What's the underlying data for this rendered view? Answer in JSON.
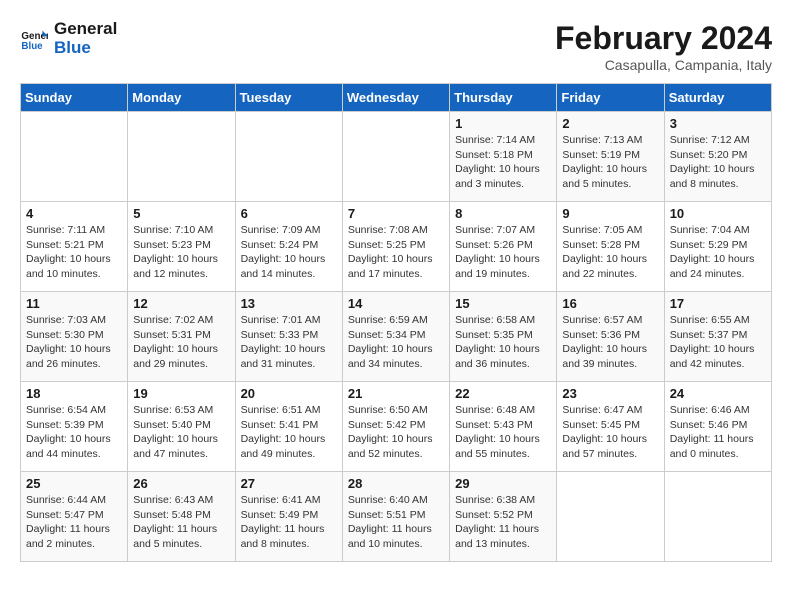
{
  "header": {
    "logo_line1": "General",
    "logo_line2": "Blue",
    "month_title": "February 2024",
    "subtitle": "Casapulla, Campania, Italy"
  },
  "weekdays": [
    "Sunday",
    "Monday",
    "Tuesday",
    "Wednesday",
    "Thursday",
    "Friday",
    "Saturday"
  ],
  "weeks": [
    [
      {
        "day": "",
        "info": ""
      },
      {
        "day": "",
        "info": ""
      },
      {
        "day": "",
        "info": ""
      },
      {
        "day": "",
        "info": ""
      },
      {
        "day": "1",
        "info": "Sunrise: 7:14 AM\nSunset: 5:18 PM\nDaylight: 10 hours\nand 3 minutes."
      },
      {
        "day": "2",
        "info": "Sunrise: 7:13 AM\nSunset: 5:19 PM\nDaylight: 10 hours\nand 5 minutes."
      },
      {
        "day": "3",
        "info": "Sunrise: 7:12 AM\nSunset: 5:20 PM\nDaylight: 10 hours\nand 8 minutes."
      }
    ],
    [
      {
        "day": "4",
        "info": "Sunrise: 7:11 AM\nSunset: 5:21 PM\nDaylight: 10 hours\nand 10 minutes."
      },
      {
        "day": "5",
        "info": "Sunrise: 7:10 AM\nSunset: 5:23 PM\nDaylight: 10 hours\nand 12 minutes."
      },
      {
        "day": "6",
        "info": "Sunrise: 7:09 AM\nSunset: 5:24 PM\nDaylight: 10 hours\nand 14 minutes."
      },
      {
        "day": "7",
        "info": "Sunrise: 7:08 AM\nSunset: 5:25 PM\nDaylight: 10 hours\nand 17 minutes."
      },
      {
        "day": "8",
        "info": "Sunrise: 7:07 AM\nSunset: 5:26 PM\nDaylight: 10 hours\nand 19 minutes."
      },
      {
        "day": "9",
        "info": "Sunrise: 7:05 AM\nSunset: 5:28 PM\nDaylight: 10 hours\nand 22 minutes."
      },
      {
        "day": "10",
        "info": "Sunrise: 7:04 AM\nSunset: 5:29 PM\nDaylight: 10 hours\nand 24 minutes."
      }
    ],
    [
      {
        "day": "11",
        "info": "Sunrise: 7:03 AM\nSunset: 5:30 PM\nDaylight: 10 hours\nand 26 minutes."
      },
      {
        "day": "12",
        "info": "Sunrise: 7:02 AM\nSunset: 5:31 PM\nDaylight: 10 hours\nand 29 minutes."
      },
      {
        "day": "13",
        "info": "Sunrise: 7:01 AM\nSunset: 5:33 PM\nDaylight: 10 hours\nand 31 minutes."
      },
      {
        "day": "14",
        "info": "Sunrise: 6:59 AM\nSunset: 5:34 PM\nDaylight: 10 hours\nand 34 minutes."
      },
      {
        "day": "15",
        "info": "Sunrise: 6:58 AM\nSunset: 5:35 PM\nDaylight: 10 hours\nand 36 minutes."
      },
      {
        "day": "16",
        "info": "Sunrise: 6:57 AM\nSunset: 5:36 PM\nDaylight: 10 hours\nand 39 minutes."
      },
      {
        "day": "17",
        "info": "Sunrise: 6:55 AM\nSunset: 5:37 PM\nDaylight: 10 hours\nand 42 minutes."
      }
    ],
    [
      {
        "day": "18",
        "info": "Sunrise: 6:54 AM\nSunset: 5:39 PM\nDaylight: 10 hours\nand 44 minutes."
      },
      {
        "day": "19",
        "info": "Sunrise: 6:53 AM\nSunset: 5:40 PM\nDaylight: 10 hours\nand 47 minutes."
      },
      {
        "day": "20",
        "info": "Sunrise: 6:51 AM\nSunset: 5:41 PM\nDaylight: 10 hours\nand 49 minutes."
      },
      {
        "day": "21",
        "info": "Sunrise: 6:50 AM\nSunset: 5:42 PM\nDaylight: 10 hours\nand 52 minutes."
      },
      {
        "day": "22",
        "info": "Sunrise: 6:48 AM\nSunset: 5:43 PM\nDaylight: 10 hours\nand 55 minutes."
      },
      {
        "day": "23",
        "info": "Sunrise: 6:47 AM\nSunset: 5:45 PM\nDaylight: 10 hours\nand 57 minutes."
      },
      {
        "day": "24",
        "info": "Sunrise: 6:46 AM\nSunset: 5:46 PM\nDaylight: 11 hours\nand 0 minutes."
      }
    ],
    [
      {
        "day": "25",
        "info": "Sunrise: 6:44 AM\nSunset: 5:47 PM\nDaylight: 11 hours\nand 2 minutes."
      },
      {
        "day": "26",
        "info": "Sunrise: 6:43 AM\nSunset: 5:48 PM\nDaylight: 11 hours\nand 5 minutes."
      },
      {
        "day": "27",
        "info": "Sunrise: 6:41 AM\nSunset: 5:49 PM\nDaylight: 11 hours\nand 8 minutes."
      },
      {
        "day": "28",
        "info": "Sunrise: 6:40 AM\nSunset: 5:51 PM\nDaylight: 11 hours\nand 10 minutes."
      },
      {
        "day": "29",
        "info": "Sunrise: 6:38 AM\nSunset: 5:52 PM\nDaylight: 11 hours\nand 13 minutes."
      },
      {
        "day": "",
        "info": ""
      },
      {
        "day": "",
        "info": ""
      }
    ]
  ]
}
